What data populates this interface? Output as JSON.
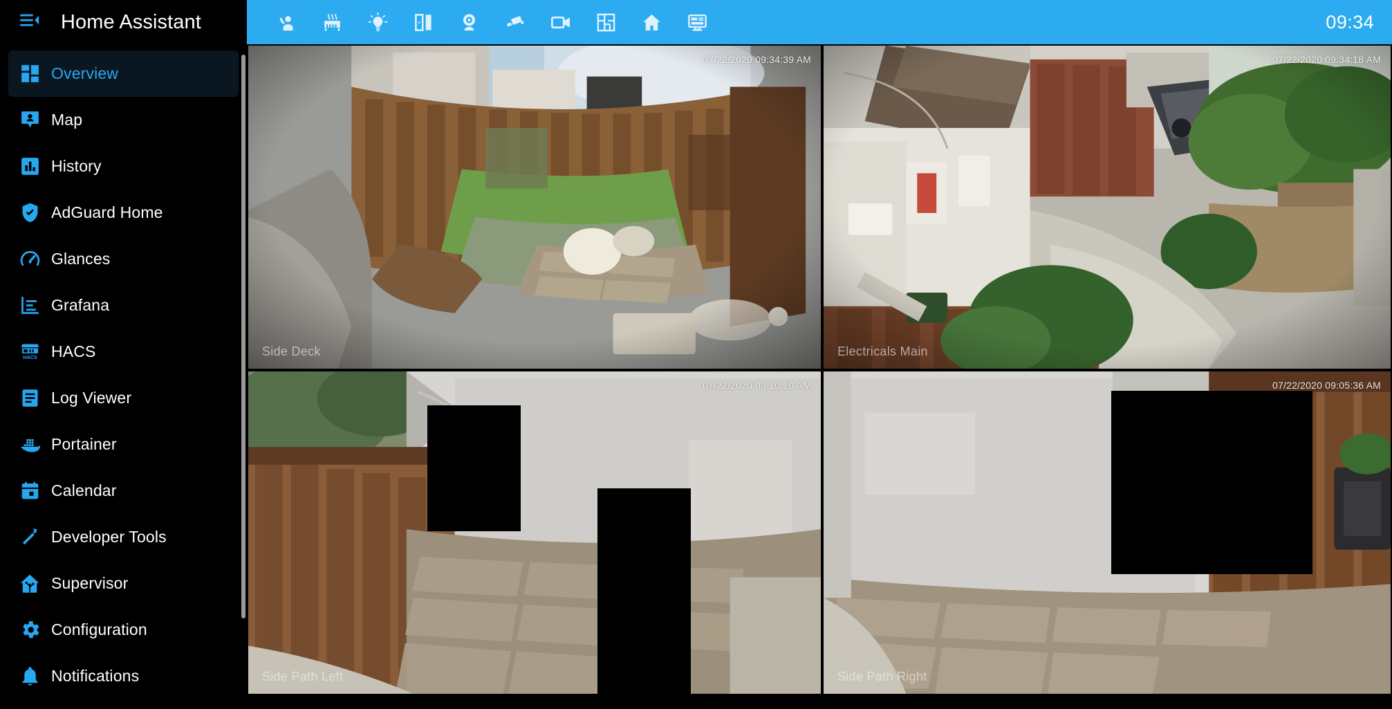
{
  "sidebar": {
    "title": "Home Assistant",
    "menu_icon": "menu-collapse-icon",
    "items": [
      {
        "label": "Overview",
        "icon": "view-dashboard-icon",
        "active": true
      },
      {
        "label": "Map",
        "icon": "map-marker-account-icon",
        "active": false
      },
      {
        "label": "History",
        "icon": "chart-box-icon",
        "active": false
      },
      {
        "label": "AdGuard Home",
        "icon": "shield-check-icon",
        "active": false
      },
      {
        "label": "Glances",
        "icon": "gauge-icon",
        "active": false
      },
      {
        "label": "Grafana",
        "icon": "chart-timeline-icon",
        "active": false
      },
      {
        "label": "HACS",
        "icon": "hacs-storefront-icon",
        "active": false
      },
      {
        "label": "Log Viewer",
        "icon": "file-document-icon",
        "active": false
      },
      {
        "label": "Portainer",
        "icon": "docker-whale-icon",
        "active": false
      },
      {
        "label": "Calendar",
        "icon": "calendar-icon",
        "active": false
      },
      {
        "label": "Developer Tools",
        "icon": "hammer-wrench-icon",
        "active": false
      },
      {
        "label": "Supervisor",
        "icon": "home-assistant-icon",
        "active": false
      },
      {
        "label": "Configuration",
        "icon": "cog-icon",
        "active": false
      },
      {
        "label": "Notifications",
        "icon": "bell-icon",
        "active": false
      }
    ]
  },
  "topbar": {
    "background": "#2cabf0",
    "clock": "09:34",
    "tabs": [
      {
        "icon": "account-presence-icon",
        "name": "tab-presence"
      },
      {
        "icon": "radiator-icon",
        "name": "tab-climate"
      },
      {
        "icon": "lightbulb-icon",
        "name": "tab-lights"
      },
      {
        "icon": "door-icon",
        "name": "tab-doors"
      },
      {
        "icon": "webcam-icon",
        "name": "tab-webcam"
      },
      {
        "icon": "cctv-icon",
        "name": "tab-cctv"
      },
      {
        "icon": "video-icon",
        "name": "tab-video"
      },
      {
        "icon": "floor-plan-icon",
        "name": "tab-floorplan"
      },
      {
        "icon": "home-icon",
        "name": "tab-home"
      },
      {
        "icon": "monitor-dashboard-icon",
        "name": "tab-monitor"
      }
    ]
  },
  "cameras": [
    {
      "name": "Side Deck",
      "timestamp": "07/22/2020 09:34:39 AM"
    },
    {
      "name": "Electricals Main",
      "timestamp": "07/22/2020 09:34:18 AM"
    },
    {
      "name": "Side Path Left",
      "timestamp": "07/22/2020 09:10:10 AM"
    },
    {
      "name": "Side Path Right",
      "timestamp": "07/22/2020 09:05:36 AM"
    }
  ],
  "colors": {
    "accent": "#26a7f0",
    "topbar": "#2cabf0",
    "sidebar_bg": "#000000",
    "active_item_bg": "#0a1721"
  }
}
